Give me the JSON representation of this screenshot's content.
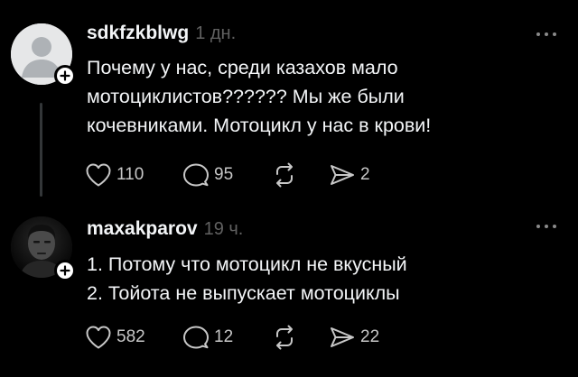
{
  "posts": [
    {
      "username": "sdkfzkblwg",
      "time": "1 дн.",
      "avatar": "default-avatar",
      "lines": [
        "Почему у нас, среди казахов мало",
        "мотоциклистов?????? Мы же были",
        "кочевниками. Мотоцикл у нас в крови!"
      ],
      "likes": "110",
      "replies": "95",
      "shares": "2"
    },
    {
      "username": "maxakparov",
      "time": "19 ч.",
      "avatar": "user-photo",
      "lines": [
        "1. Потому что мотоцикл не вкусный",
        "2. Тойота не выпускает мотоциклы"
      ],
      "likes": "582",
      "replies": "12",
      "shares": "22"
    }
  ],
  "colors": {
    "background": "#000000",
    "text": "#f3f5f7",
    "muted": "#616161",
    "icon": "#c7c7c7",
    "thread_line": "#333638"
  }
}
